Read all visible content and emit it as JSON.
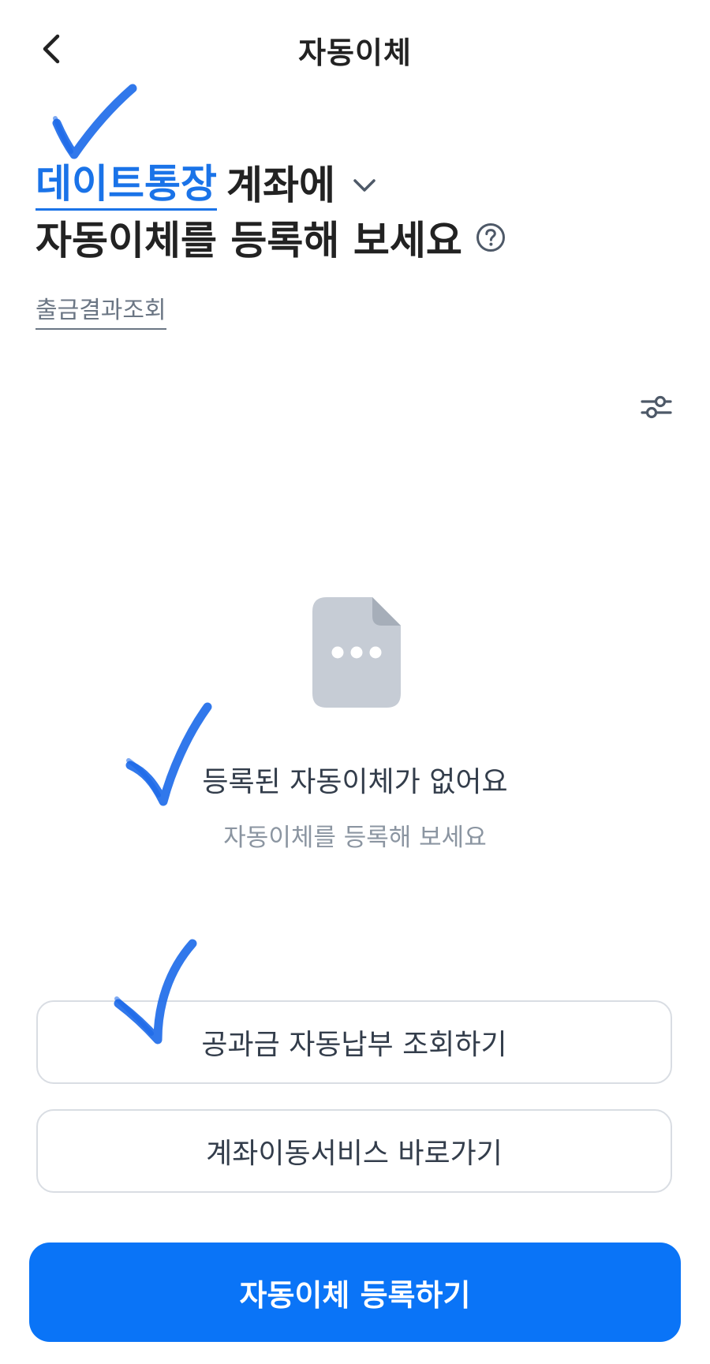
{
  "header": {
    "title": "자동이체",
    "back_icon": "chevron-left-icon"
  },
  "heading": {
    "account_name": "데이트통장",
    "account_suffix": "계좌에",
    "line2": "자동이체를 등록해 보세요",
    "dropdown_icon": "chevron-down-icon",
    "help_icon": "question-circle-icon"
  },
  "withdrawal_result_link": "출금결과조회",
  "filter_icon": "filter-sliders-icon",
  "empty_state": {
    "icon": "document-more-icon",
    "title": "등록된 자동이체가 없어요",
    "subtitle": "자동이체를 등록해 보세요"
  },
  "buttons": {
    "utility_autopay": "공과금 자동납부 조회하기",
    "account_transfer_service": "계좌이동서비스 바로가기",
    "register_autopay": "자동이체 등록하기"
  },
  "colors": {
    "accent": "#0a74f7",
    "account_name": "#1a73e8",
    "annotation": "#1565e8"
  }
}
